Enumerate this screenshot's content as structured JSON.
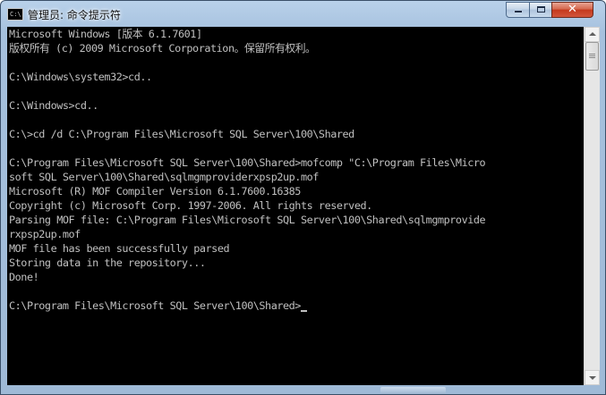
{
  "window": {
    "title": "管理员: 命令提示符",
    "icon": "cmd-icon",
    "icon_text": "C:\\",
    "controls": {
      "minimize_icon": "minimize-icon",
      "maximize_icon": "maximize-icon",
      "close_icon": "close-icon",
      "close_glyph": "✕"
    },
    "accent_color": "#b9d1ea",
    "close_color": "#c4391d"
  },
  "console": {
    "background": "#000000",
    "text_color": "#c0c0c0",
    "lines": [
      "Microsoft Windows [版本 6.1.7601]",
      "版权所有 (c) 2009 Microsoft Corporation。保留所有权利。",
      "",
      "C:\\Windows\\system32>cd..",
      "",
      "C:\\Windows>cd..",
      "",
      "C:\\>cd /d C:\\Program Files\\Microsoft SQL Server\\100\\Shared",
      "",
      "C:\\Program Files\\Microsoft SQL Server\\100\\Shared>mofcomp \"C:\\Program Files\\Micro",
      "soft SQL Server\\100\\Shared\\sqlmgmproviderxpsp2up.mof",
      "Microsoft (R) MOF Compiler Version 6.1.7600.16385",
      "Copyright (c) Microsoft Corp. 1997-2006. All rights reserved.",
      "Parsing MOF file: C:\\Program Files\\Microsoft SQL Server\\100\\Shared\\sqlmgmprovide",
      "rxpsp2up.mof",
      "MOF file has been successfully parsed",
      "Storing data in the repository...",
      "Done!",
      "",
      "C:\\Program Files\\Microsoft SQL Server\\100\\Shared>"
    ]
  },
  "scrollbar": {
    "up_icon": "scroll-up-arrow-icon",
    "down_icon": "scroll-down-arrow-icon",
    "position": 0
  }
}
